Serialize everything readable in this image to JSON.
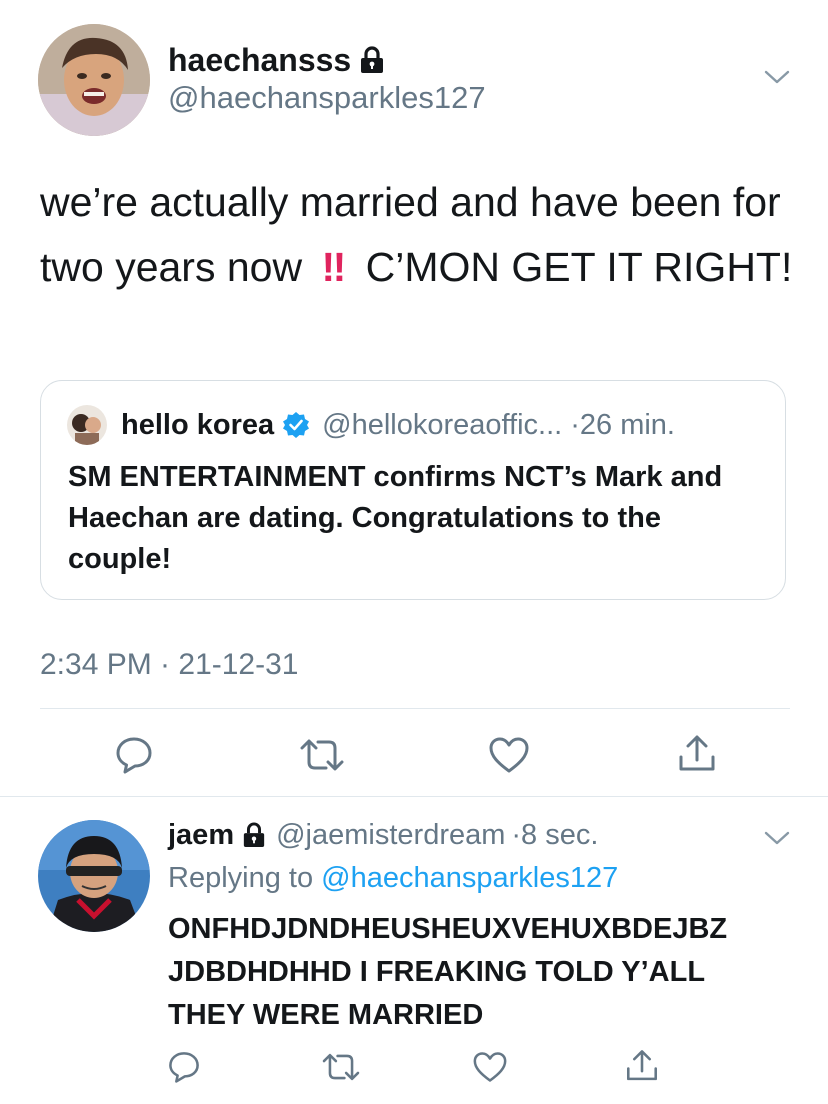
{
  "main_tweet": {
    "display_name": "haechansss",
    "handle": "@haechansparkles127",
    "text_part1": "we’re actually married and have been for two years now",
    "emphasis": "‼",
    "text_part2": "C’MON GET IT RIGHT!",
    "timestamp": "2:34 PM · 21-12-31"
  },
  "quoted_tweet": {
    "display_name": "hello korea",
    "handle": "@hellokoreaoffic...",
    "time": "·26 min.",
    "text": "SM ENTERTAINMENT confirms NCT’s Mark and Haechan are dating. Congratulations to the couple!"
  },
  "reply_tweet": {
    "display_name": "jaem",
    "handle": "@jaemisterdream",
    "time": "·8 sec.",
    "replying_prefix": "Replying to",
    "replying_handle": "@haechansparkles127",
    "text": "ONFHDJDNDHEUSHEUXVEHUXBDEJBZ JDBDHDHHD I FREAKING TOLD Y’ALL THEY WERE MARRIED"
  },
  "icons": {
    "actions": [
      "reply-icon",
      "retweet-icon",
      "like-icon",
      "share-icon"
    ],
    "lock": "lock-icon",
    "verified": "verified-badge-icon",
    "menu": "chevron-down-icon"
  },
  "colors": {
    "accent": "#1da1f2",
    "muted": "#657786",
    "text": "#14171a",
    "divider": "#e1e8ed",
    "emphasis": "#e0245e"
  }
}
